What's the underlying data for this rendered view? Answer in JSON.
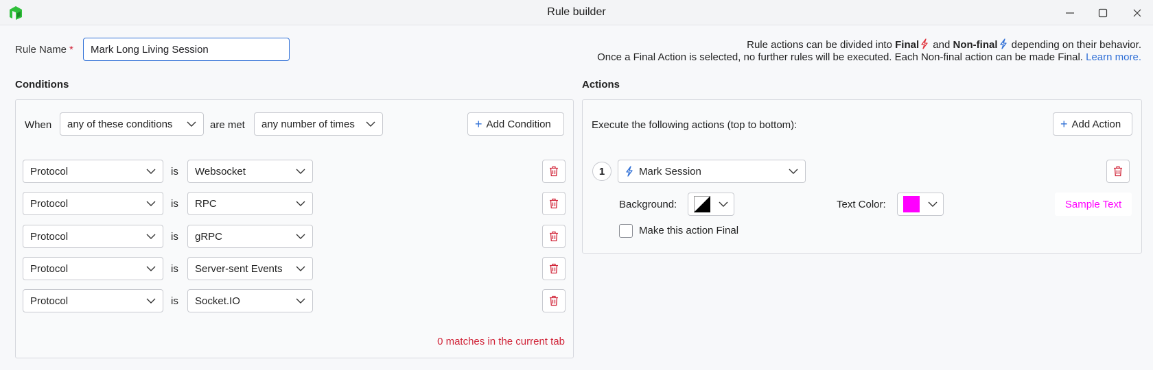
{
  "window": {
    "title": "Rule builder"
  },
  "rule_name": {
    "label": "Rule Name",
    "required_mark": "*",
    "value": "Mark Long Living Session"
  },
  "info": {
    "line1_prefix": "Rule actions can be divided into",
    "final": "Final",
    "and": "and",
    "non_final": "Non-final",
    "line1_suffix": "depending on their behavior.",
    "line2": "Once a Final Action is selected, no further rules will be executed. Each Non-final action can be made Final.",
    "learn_more": "Learn more."
  },
  "conditions": {
    "title": "Conditions",
    "when_label": "When",
    "match_mode": "any of these conditions",
    "are_met_label": "are met",
    "frequency": "any number of times",
    "add_button": "Add Condition",
    "is_label": "is",
    "rows": [
      {
        "field": "Protocol",
        "value": "Websocket"
      },
      {
        "field": "Protocol",
        "value": "RPC"
      },
      {
        "field": "Protocol",
        "value": "gRPC"
      },
      {
        "field": "Protocol",
        "value": "Server-sent Events"
      },
      {
        "field": "Protocol",
        "value": "Socket.IO"
      }
    ],
    "matches_text": "0 matches in the current tab"
  },
  "actions": {
    "title": "Actions",
    "execute_label": "Execute the following actions (top to bottom):",
    "add_button": "Add Action",
    "items": [
      {
        "number": "1",
        "type": "Mark Session",
        "background_label": "Background:",
        "text_color_label": "Text Color:",
        "sample_text": "Sample Text",
        "make_final_label": "Make this action Final",
        "make_final_checked": false
      }
    ]
  },
  "colors": {
    "accent": "#2f6fd6",
    "danger": "#d1263a",
    "final_bolt": "#e0323c",
    "nonfinal_bolt": "#2f6fd6",
    "text_color_swatch": "#ff00ff",
    "logo": "#2fbf3a"
  }
}
